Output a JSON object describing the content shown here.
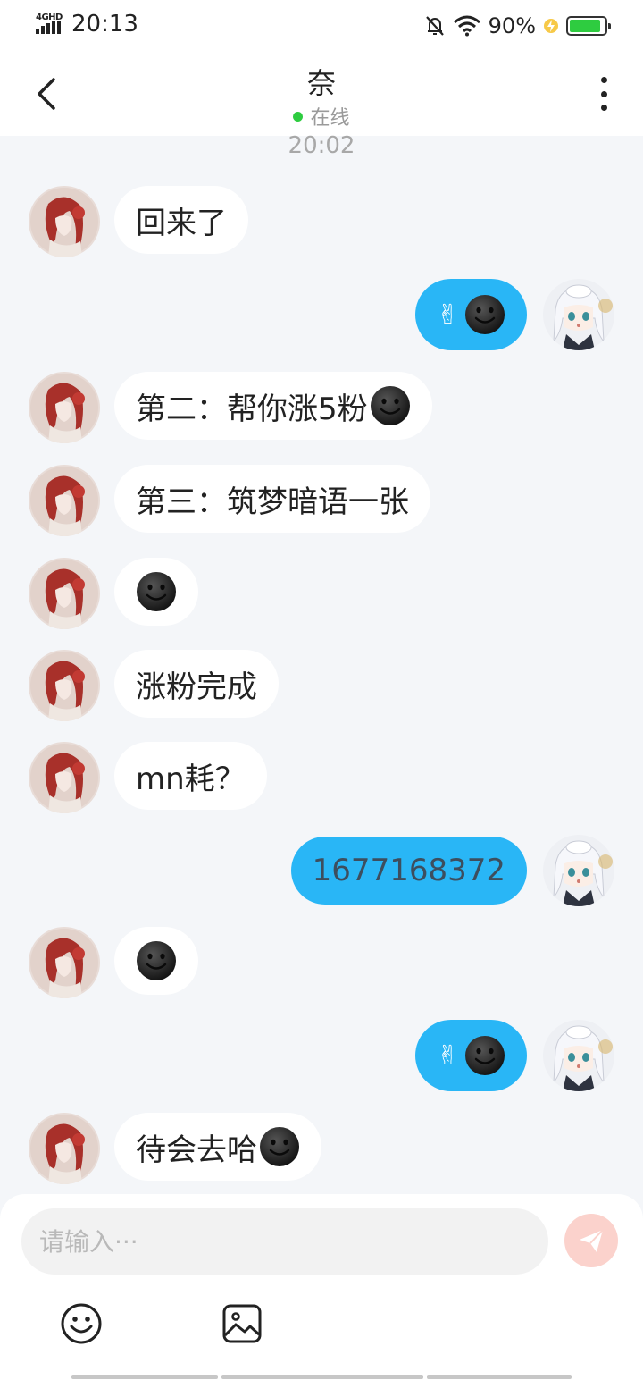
{
  "status_bar": {
    "network": "4GHD",
    "time": "20:13",
    "battery": "90%",
    "battery_level": 0.9
  },
  "header": {
    "name": "奈",
    "status": "在线",
    "status_color": "#2ecc40"
  },
  "chat": {
    "timestamp": "20:02",
    "messages": [
      {
        "side": "in",
        "text": "回来了",
        "emoji": false
      },
      {
        "side": "out",
        "text": "",
        "emoji": true,
        "hand": "✌"
      },
      {
        "side": "in",
        "text": "第二：帮你涨5粉",
        "emoji": true
      },
      {
        "side": "in",
        "text": "第三：筑梦暗语一张",
        "emoji": false
      },
      {
        "side": "in",
        "text": "",
        "emoji": true
      },
      {
        "side": "in",
        "text": "涨粉完成",
        "emoji": false
      },
      {
        "side": "in",
        "text": "mn耗？",
        "emoji": false
      },
      {
        "side": "out",
        "text": "1677168372",
        "emoji": false
      },
      {
        "side": "in",
        "text": "",
        "emoji": true
      },
      {
        "side": "out",
        "text": "",
        "emoji": true,
        "hand": "✌"
      },
      {
        "side": "in",
        "text": "待会去哈",
        "emoji": true
      }
    ]
  },
  "input": {
    "placeholder": "请输入···"
  },
  "colors": {
    "outgoing_bubble": "#29b6f6",
    "incoming_bubble": "#ffffff",
    "send_button": "#fbd2cc",
    "background": "#f4f6f9"
  },
  "icons": {
    "back": "chevron-left-icon",
    "more": "more-vertical-icon",
    "send": "paper-plane-icon",
    "emoji": "smiley-icon",
    "image": "image-icon"
  }
}
